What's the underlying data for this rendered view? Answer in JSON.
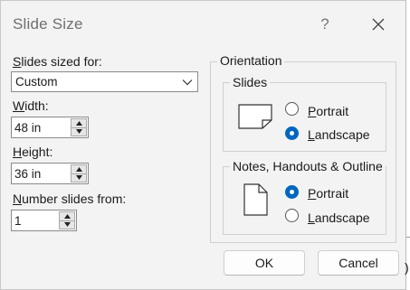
{
  "dialog": {
    "title": "Slide Size",
    "help_glyph": "?"
  },
  "left": {
    "sized_for": {
      "label_u": "S",
      "label_rest": "lides sized for:",
      "value": "Custom"
    },
    "width": {
      "label_u": "W",
      "label_rest": "idth:",
      "value": "48 in"
    },
    "height": {
      "label_u": "H",
      "label_rest": "eight:",
      "value": "36 in"
    },
    "number_from": {
      "label_u": "N",
      "label_rest": "umber slides from:",
      "value": "1"
    }
  },
  "orientation": {
    "title": "Orientation",
    "slides": {
      "title": "Slides",
      "portrait": {
        "label_u": "P",
        "label_rest": "ortrait",
        "selected": false
      },
      "landscape": {
        "label_u": "L",
        "label_rest": "andscape",
        "selected": true
      }
    },
    "notes": {
      "title": "Notes, Handouts & Outline",
      "portrait": {
        "label_u": "P",
        "label_rest": "ortrait",
        "selected": true
      },
      "landscape": {
        "label_u": "L",
        "label_rest": "andscape",
        "selected": false
      }
    }
  },
  "buttons": {
    "ok": "OK",
    "cancel": "Cancel"
  },
  "edge": {
    "clipped_glyph": ")"
  },
  "icons": {
    "help": "question-icon",
    "close": "close-icon",
    "dropdown": "chevron-down-icon",
    "spin_up": "spin-up-icon",
    "spin_down": "spin-down-icon",
    "landscape_page": "landscape-page-icon",
    "portrait_page": "portrait-page-icon"
  },
  "colors": {
    "accent": "#0067c0",
    "dialog_bg": "#f3f3f3"
  }
}
